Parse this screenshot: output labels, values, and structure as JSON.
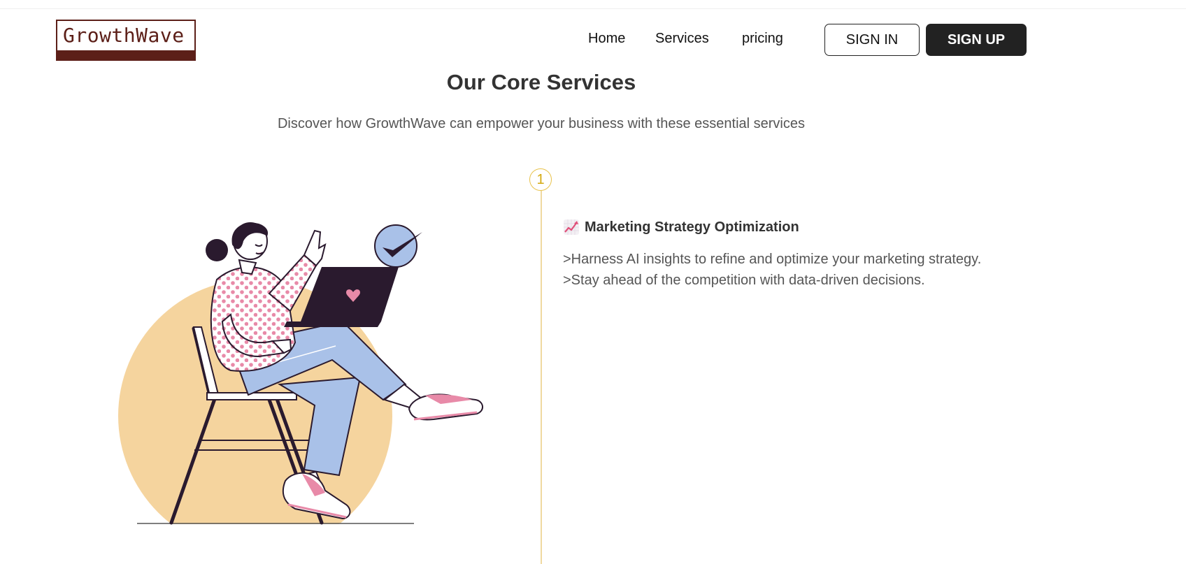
{
  "brand": {
    "name": "GrowthWave"
  },
  "nav": {
    "items": [
      {
        "label": "Home"
      },
      {
        "label": "Services"
      },
      {
        "label": "pricing"
      }
    ],
    "sign_in_label": "SIGN IN",
    "sign_up_label": "SIGN UP"
  },
  "section": {
    "title": "Our Core Services",
    "subtitle": "Discover how GrowthWave can empower your business with these essential services"
  },
  "services": [
    {
      "step": "1",
      "icon": "chart-increasing-icon",
      "title": "Marketing Strategy Optimization",
      "lines": [
        ">Harness AI insights to refine and optimize your marketing strategy.",
        ">Stay ahead of the competition with data-driven decisions."
      ]
    }
  ],
  "colors": {
    "brand": "#5c1f18",
    "step_accent": "#e8c24a",
    "button_dark": "#222222",
    "illustration_circle": "#f5d49e",
    "illustration_jeans": "#a9c1e8",
    "illustration_accent": "#e88aa8"
  }
}
